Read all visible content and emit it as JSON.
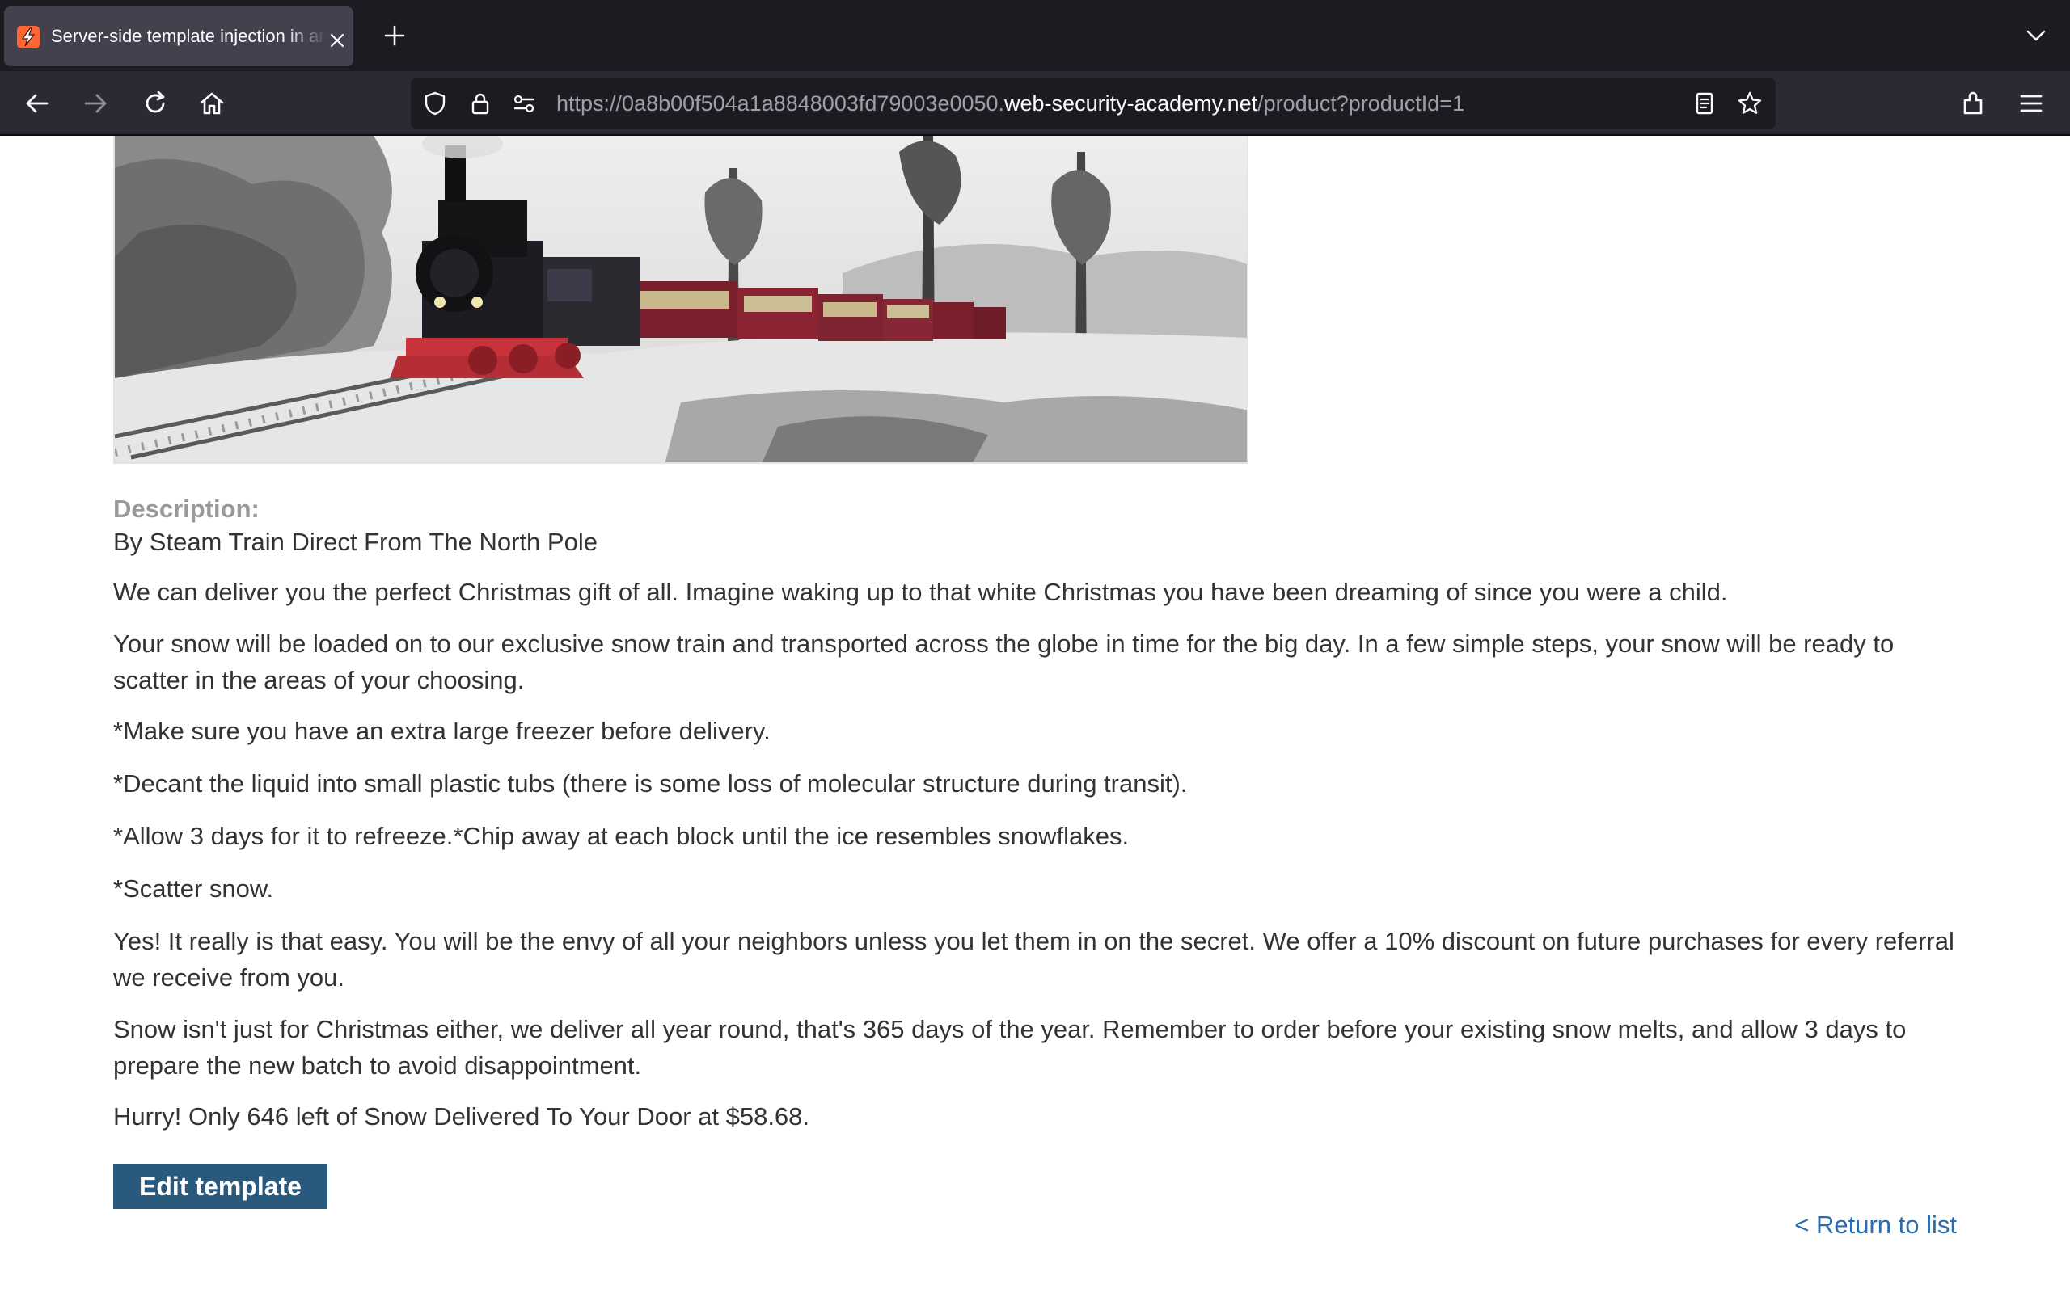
{
  "browser": {
    "tab_title": "Server-side template injection in an unknown language with a documented exploit",
    "url_prefix": "https://0a8b00f504a1a8848003fd79003e0050.",
    "url_host": "web-security-academy.net",
    "url_path": "/product?productId=1"
  },
  "product": {
    "image_alt": "Steam train in a snowy forest",
    "description_label": "Description:",
    "paragraphs": [
      "By Steam Train Direct From The North Pole",
      "We can deliver you the perfect Christmas gift of all. Imagine waking up to that white Christmas you have been dreaming of since you were a child.",
      "Your snow will be loaded on to our exclusive snow train and transported across the globe in time for the big day. In a few simple steps, your snow will be ready to scatter in the areas of your choosing.",
      "*Make sure you have an extra large freezer before delivery.",
      "*Decant the liquid into small plastic tubs (there is some loss of molecular structure during transit).",
      "*Allow 3 days for it to refreeze.*Chip away at each block until the ice resembles snowflakes.",
      "*Scatter snow.",
      "Yes! It really is that easy. You will be the envy of all your neighbors unless you let them in on the secret. We offer a 10% discount on future purchases for every referral we receive from you.",
      "Snow isn't just for Christmas either, we deliver all year round, that's 365 days of the year. Remember to order before your existing snow melts, and allow 3 days to prepare the new batch to avoid disappointment.",
      "Hurry! Only 646 left of Snow Delivered To Your Door at $58.68."
    ],
    "edit_template_label": "Edit template",
    "return_link_label": "< Return to list"
  },
  "colors": {
    "button_bg": "#29597d",
    "link": "#2b6cb0",
    "label_gray": "#999999",
    "text": "#333333"
  },
  "icons": [
    "lightning-icon",
    "close-icon",
    "plus-icon",
    "chevron-down-icon",
    "back-arrow-icon",
    "forward-arrow-icon",
    "reload-icon",
    "home-icon",
    "shield-icon",
    "lock-icon",
    "permissions-icon",
    "reader-view-icon",
    "star-icon",
    "extensions-icon",
    "menu-icon"
  ]
}
